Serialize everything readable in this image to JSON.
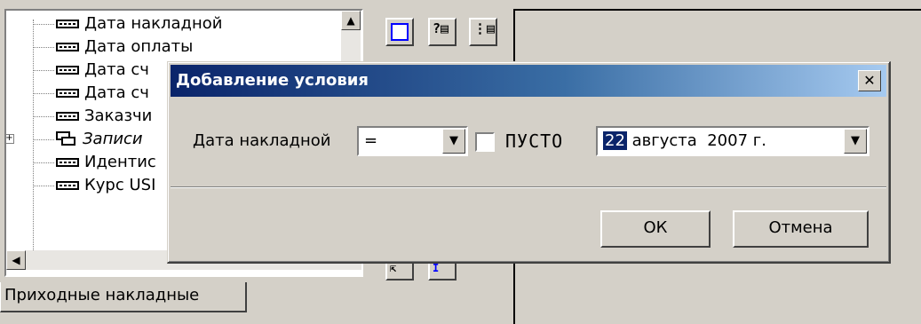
{
  "tree": {
    "items": [
      {
        "label": "Дата накладной",
        "type": "field"
      },
      {
        "label": "Дата оплаты",
        "type": "field"
      },
      {
        "label": "Дата сч",
        "type": "field"
      },
      {
        "label": "Дата сч",
        "type": "field"
      },
      {
        "label": "Заказчи",
        "type": "field"
      },
      {
        "label": "Записи",
        "type": "group"
      },
      {
        "label": "Идентис",
        "type": "field"
      },
      {
        "label": "Курс USI",
        "type": "field"
      }
    ]
  },
  "tabs": {
    "active_label": "Приходные накладные"
  },
  "dialog": {
    "title": "Добавление условия",
    "close_glyph": "✕",
    "field_label": "Дата накладной",
    "operator": {
      "value": "="
    },
    "empty_checkbox": {
      "label": "ПУСТО",
      "checked": false
    },
    "date": {
      "day": "22",
      "rest": " августа  2007 г."
    },
    "ok_label": "ОК",
    "cancel_label": "Отмена"
  }
}
